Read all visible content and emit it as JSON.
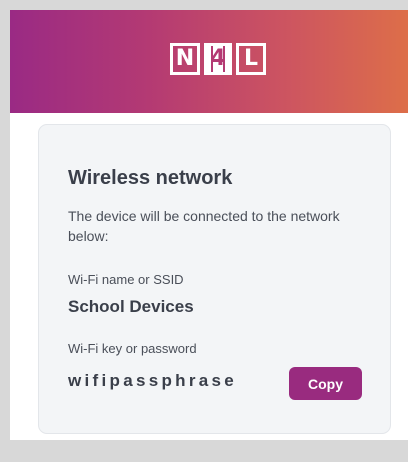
{
  "header": {
    "logo": {
      "letters": [
        "N",
        "4",
        "L"
      ],
      "brand_colors": [
        "#9a2a84",
        "#dd6e49"
      ]
    }
  },
  "card": {
    "title": "Wireless network",
    "description": "The device will be connected to the network below:",
    "ssid": {
      "label": "Wi-Fi name or SSID",
      "value": "School Devices"
    },
    "password": {
      "label": "Wi-Fi key or password",
      "value": "wifipassphrase"
    },
    "copy_button": {
      "label": "Copy",
      "color": "#992b7f"
    }
  }
}
